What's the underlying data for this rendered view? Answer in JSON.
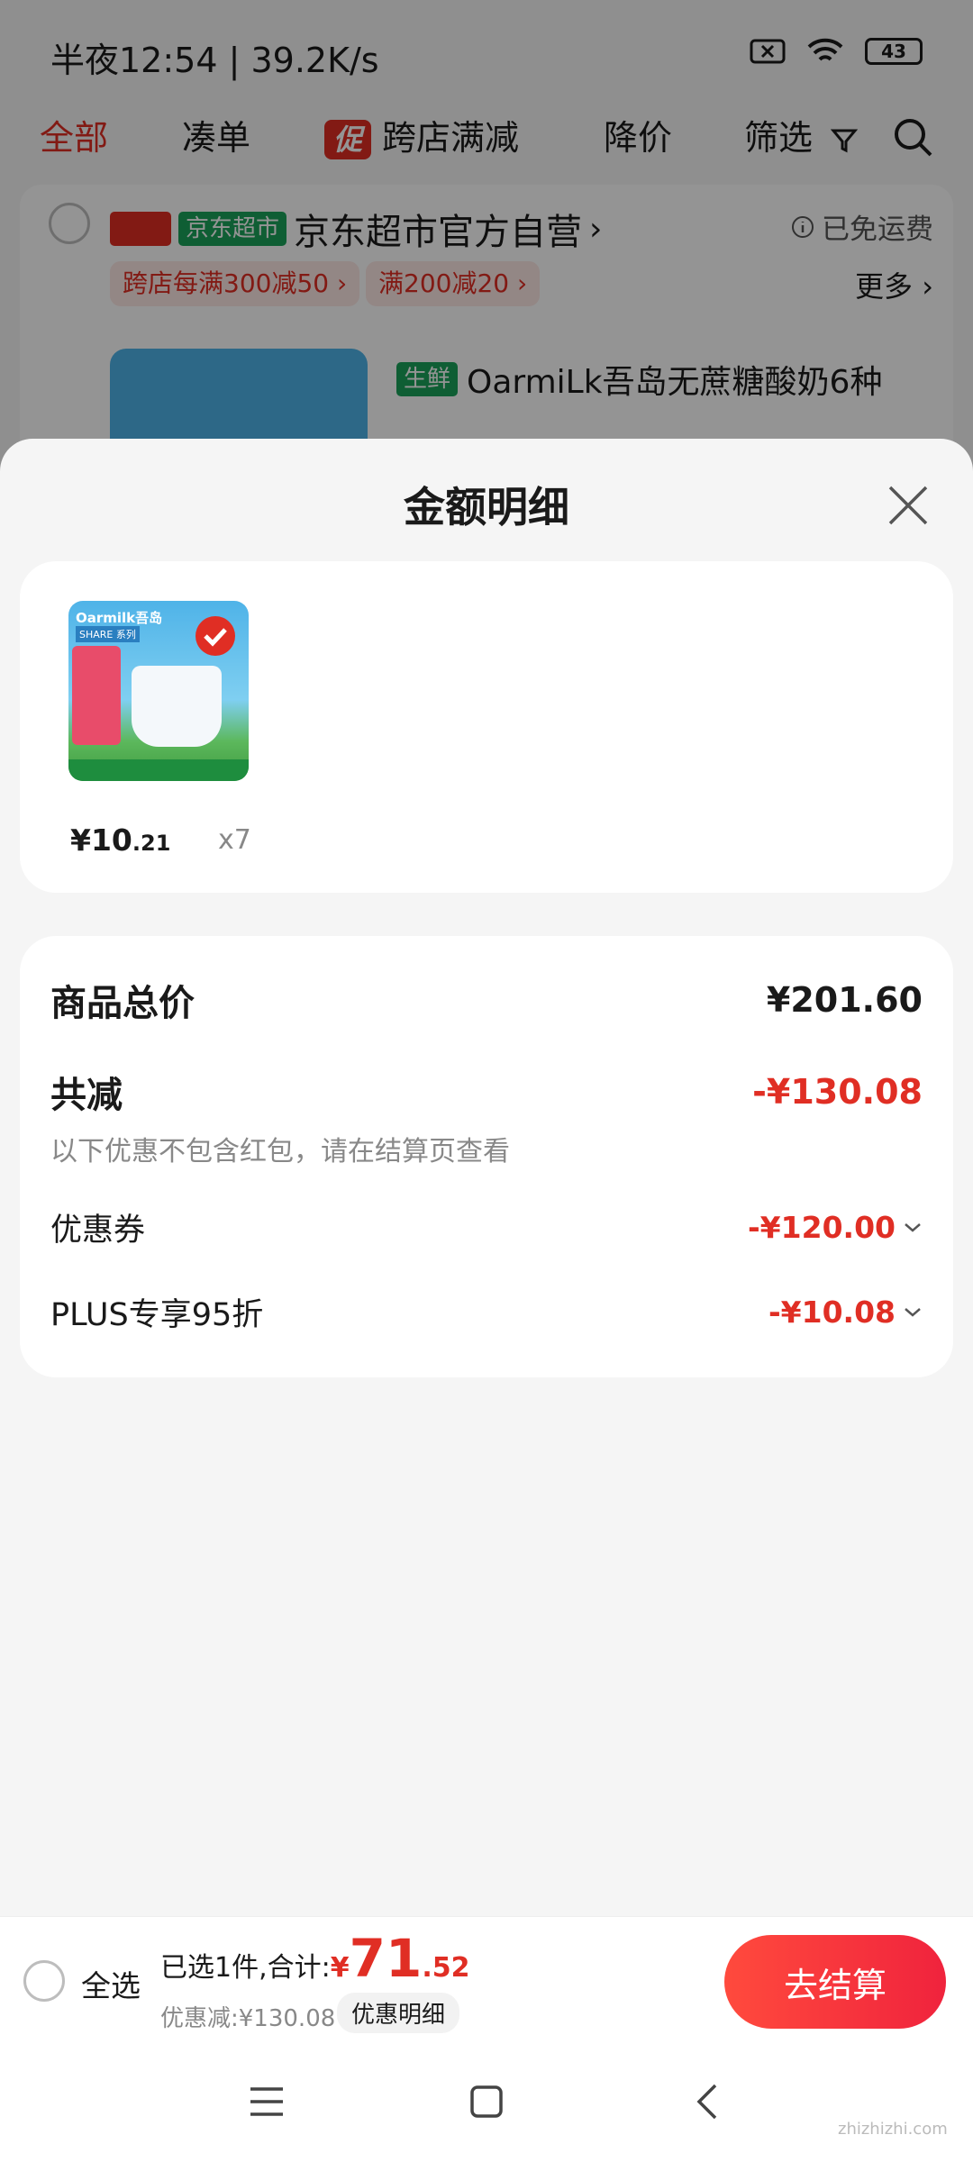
{
  "status_bar": {
    "time_speed": "半夜12:54 | 39.2K/s",
    "battery": "43"
  },
  "tabs": [
    {
      "label": "全部",
      "active": true
    },
    {
      "label": "凑单"
    },
    {
      "label": "跨店满减",
      "badge": "促"
    },
    {
      "label": "降价"
    },
    {
      "label": "筛选"
    }
  ],
  "store": {
    "tag_self": "自营",
    "tag_market": "京东超市",
    "name": "京东超市官方自营",
    "shipping": "已免运费",
    "chips": [
      "跨店每满300减50 ›",
      "满200减20 ›"
    ],
    "more": "更多 ›",
    "product_tag": "生鲜",
    "product_name": "OarmiLk吾岛无蔗糖酸奶6种"
  },
  "sheet": {
    "title": "金额明细",
    "item": {
      "price_int": "¥10",
      "price_dec": ".21",
      "qty": "x7",
      "thumb_brand": "Oarmilk吾岛",
      "thumb_series": "SHARE 系列"
    },
    "summary": {
      "total_label": "商品总价",
      "total_value": "¥201.60",
      "reduce_label": "共减",
      "reduce_value": "-¥130.08",
      "note": "以下优惠不包含红包，请在结算页查看",
      "coupon_label": "优惠券",
      "coupon_value": "-¥120.00",
      "plus_label": "PLUS专享95折",
      "plus_value": "-¥10.08"
    }
  },
  "bottom_bar": {
    "select_all": "全选",
    "selected_text": "已选1件,合计:",
    "total_symbol": "¥",
    "total_int": "71",
    "total_dec": ".52",
    "discount_text": "优惠减:¥130.08",
    "detail_button": "优惠明细",
    "checkout": "去结算"
  },
  "watermark": "zhizhizhi.com"
}
